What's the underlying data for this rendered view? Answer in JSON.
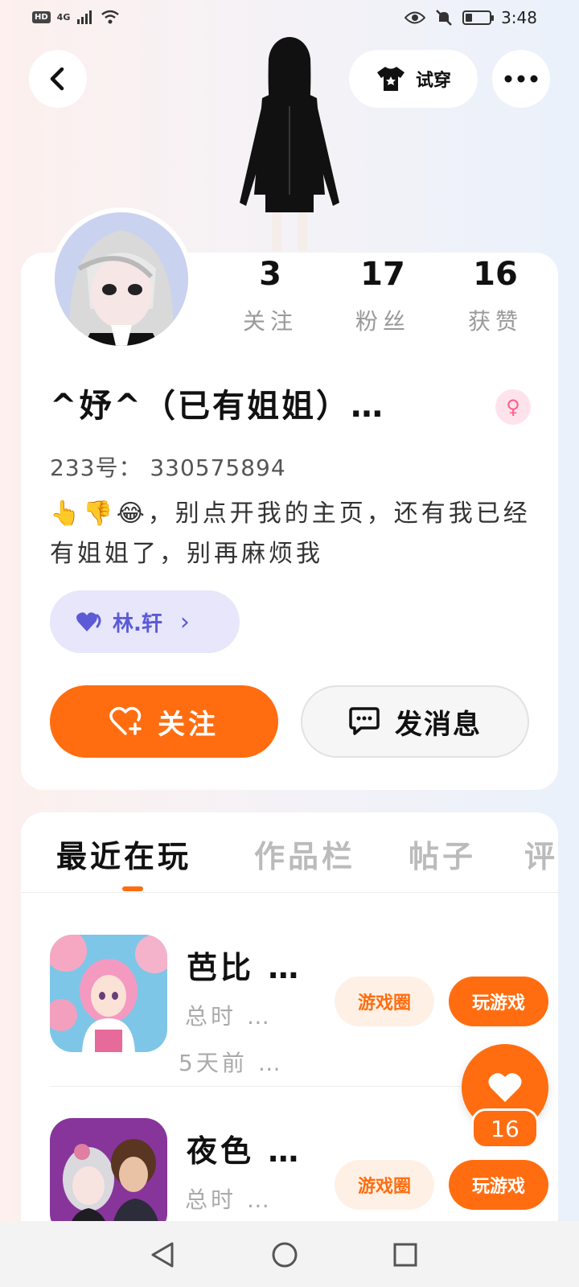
{
  "status_bar": {
    "left_badge": "HD",
    "network": "4G",
    "time": "3:48",
    "battery_level": 0.3
  },
  "top_bar": {
    "back_icon": "back-arrow-icon",
    "tryon_label": "试穿",
    "tryon_icon": "tshirt-icon",
    "more_icon": "more-dots-icon"
  },
  "profile": {
    "stats": [
      {
        "value": "3",
        "label": "关注"
      },
      {
        "value": "17",
        "label": "粉丝"
      },
      {
        "value": "16",
        "label": "获赞"
      }
    ],
    "nickname": "^妤^（已有姐姐）…",
    "gender_symbol": "♀",
    "uid": "233号： 330575894",
    "bio": "👆👎😂，别点开我的主页，还有我已经有姐姐了，别再麻烦我",
    "bond_name": "林.轩",
    "bond_chevron": "›",
    "follow_label": "关注",
    "message_label": "发消息"
  },
  "tabs": [
    {
      "label": "最近在玩",
      "active": true
    },
    {
      "label": "作品栏",
      "active": false
    },
    {
      "label": "帖子",
      "active": false
    },
    {
      "label": "评",
      "active": false
    }
  ],
  "games": [
    {
      "title": "芭比 …",
      "playtime": "总时 …",
      "last_played": "5天前 …",
      "circle_label": "游戏圈",
      "play_label": "玩游戏"
    },
    {
      "title": "夜色 …",
      "playtime": "总时 …",
      "last_played": "",
      "circle_label": "游戏圈",
      "play_label": "玩游戏"
    }
  ],
  "like_fab": {
    "count": "16"
  },
  "colors": {
    "accent": "#ff6d10",
    "accent_light": "#fff0e5",
    "bond_bg": "#e7e6fb",
    "bond_text": "#5b5bd6",
    "gender": "#ff5f8b"
  }
}
